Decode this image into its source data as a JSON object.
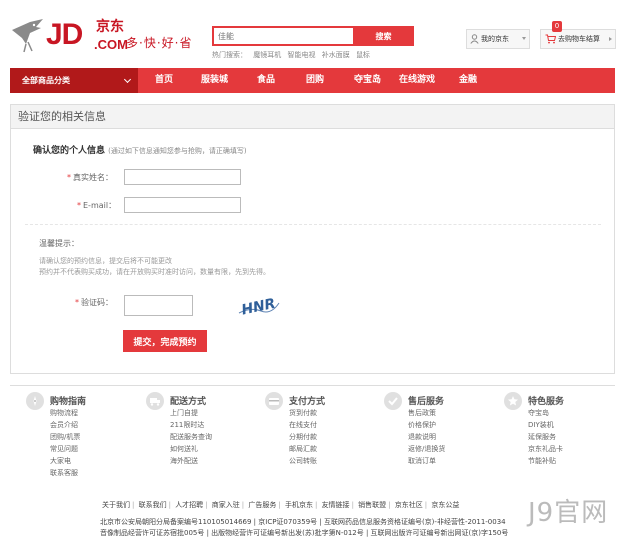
{
  "header": {
    "logo_brand": "JD",
    "logo_cn": "京东",
    "logo_com": ".COM",
    "logo_slogan": "多·快·好·省",
    "search_placeholder": "佳能",
    "search_button": "搜索",
    "hot_label": "热门搜索：",
    "hot_items": [
      "魔镜耳机",
      "智能电视",
      "补水面膜",
      "鼠标"
    ],
    "my_jd": "我的京东",
    "cart_label": "去购物车结算",
    "cart_count": "0"
  },
  "nav": {
    "category": "全部商品分类",
    "items": [
      "首页",
      "服装城",
      "食品",
      "团购",
      "夺宝岛",
      "在线游戏",
      "金融"
    ]
  },
  "panel": {
    "title": "验证您的相关信息",
    "section_title": "确认您的个人信息",
    "section_note": "(通过如下信息通知您参与抢购，请正确填写)",
    "name_label": "真实姓名：",
    "email_label": "E-mail：",
    "tips_title": "温馨提示：",
    "tips": [
      "请确认您的预约信息，提交后将不可能更改",
      "预约并不代表购买成功，请在开放购买时准时访问，数量有限，先到先得。"
    ],
    "captcha_label": "验证码：",
    "captcha_text": "HNR",
    "submit": "提交，完成预约"
  },
  "footer": {
    "columns": [
      {
        "title": "购物指南",
        "icon": "guide-icon",
        "links": [
          "购物流程",
          "会员介绍",
          "团购/机票",
          "常见问题",
          "大家电",
          "联系客服"
        ]
      },
      {
        "title": "配送方式",
        "icon": "delivery-icon",
        "links": [
          "上门自提",
          "211限时达",
          "配送服务查询",
          "如何送礼",
          "海外配送"
        ]
      },
      {
        "title": "支付方式",
        "icon": "payment-icon",
        "links": [
          "货到付款",
          "在线支付",
          "分期付款",
          "邮局汇款",
          "公司转账"
        ]
      },
      {
        "title": "售后服务",
        "icon": "aftersale-icon",
        "links": [
          "售后政策",
          "价格保护",
          "退款说明",
          "返修/退换货",
          "取消订单"
        ]
      },
      {
        "title": "特色服务",
        "icon": "special-icon",
        "links": [
          "夺宝岛",
          "DIY装机",
          "延保服务",
          "京东礼品卡",
          "节能补贴"
        ]
      }
    ],
    "bottom_links": [
      "关于我们",
      "联系我们",
      "人才招聘",
      "商家入驻",
      "广告服务",
      "手机京东",
      "友情链接",
      "销售联盟",
      "京东社区",
      "京东公益"
    ],
    "license_1": "北京市公安局朝阳分局备案编号110105014669 | 京ICP证070359号 | 互联网药品信息服务资格证编号(京)-非经营性-2011-0034",
    "license_2": "音像制品经营许可证苏宿批005号 | 出版物经营许可证编号新出发(苏)批字第N-012号 | 互联网出版许可证编号新出网证(京)字150号",
    "watermark": "J9官网"
  }
}
